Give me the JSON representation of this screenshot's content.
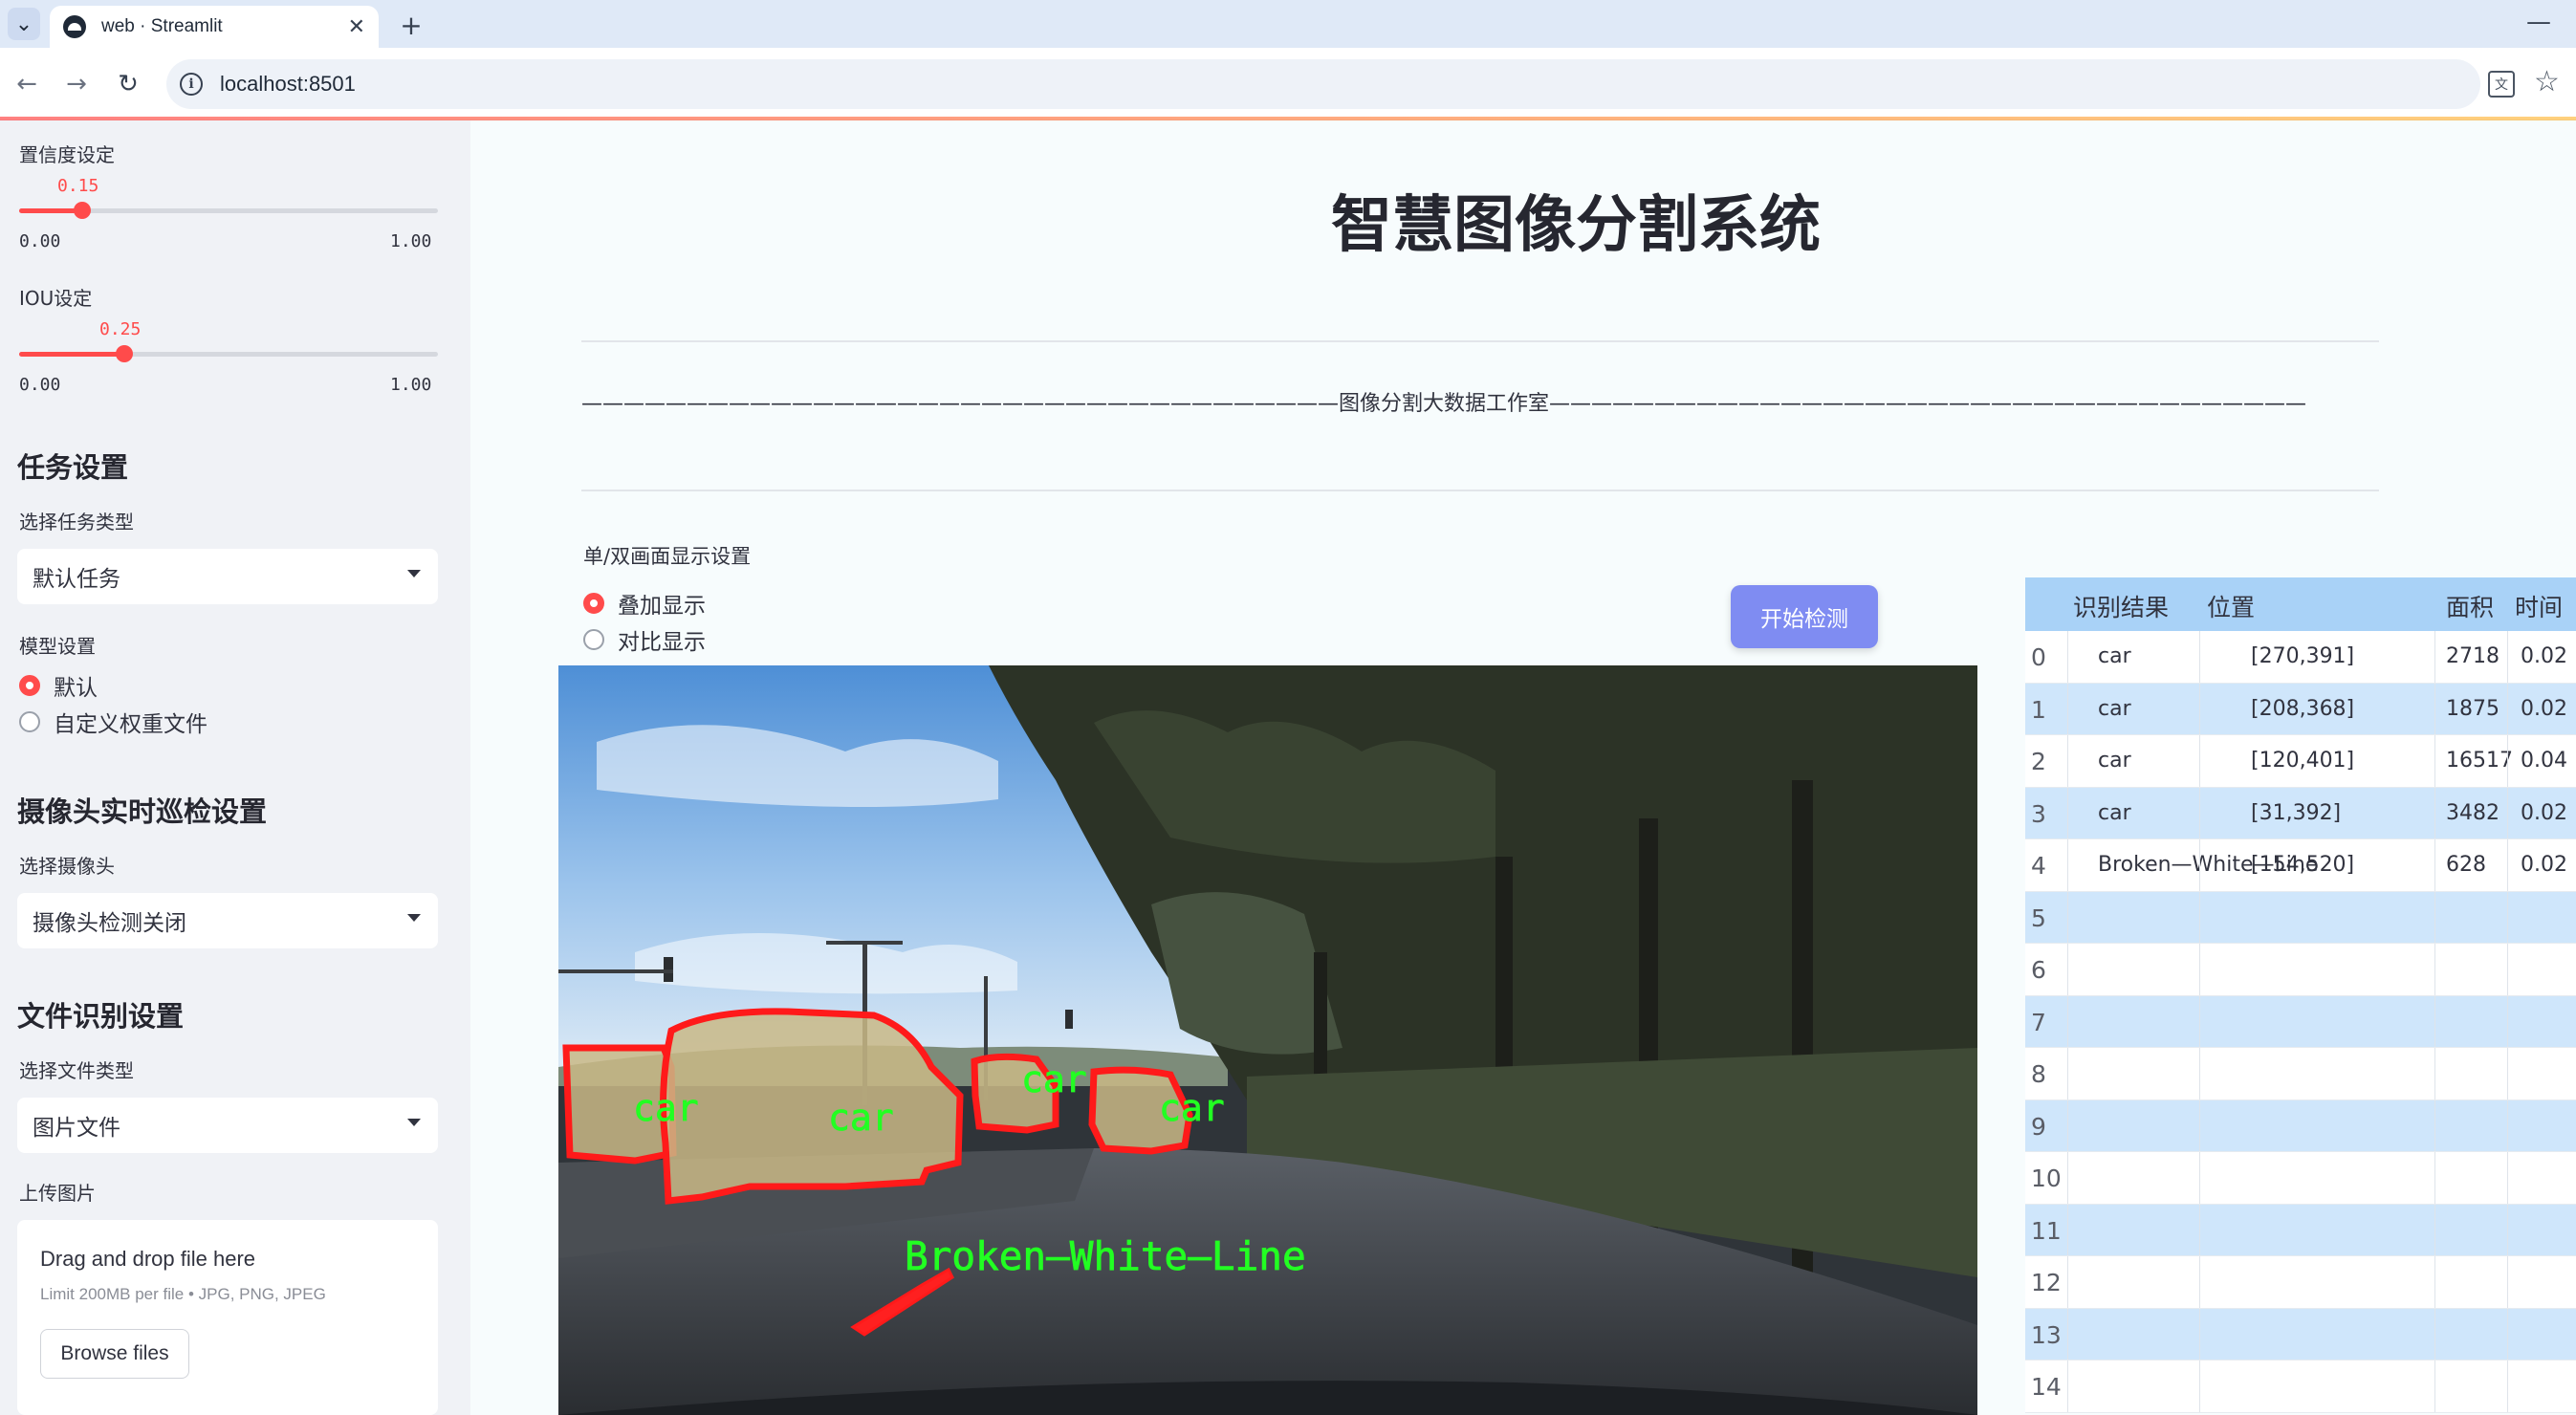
{
  "browser": {
    "tab_title": "web · Streamlit",
    "url": "localhost:8501"
  },
  "sidebar": {
    "confidence": {
      "label": "置信度设定",
      "value": "0.15",
      "min": "0.00",
      "max": "1.00",
      "fraction": 0.15
    },
    "iou": {
      "label": "IOU设定",
      "value": "0.25",
      "min": "0.00",
      "max": "1.00",
      "fraction": 0.25
    },
    "task_heading": "任务设置",
    "task_type_label": "选择任务类型",
    "task_type_value": "默认任务",
    "model_label": "模型设置",
    "model_options": [
      "默认",
      "自定义权重文件"
    ],
    "model_selected": 0,
    "camera_heading": "摄像头实时巡检设置",
    "camera_label": "选择摄像头",
    "camera_value": "摄像头检测关闭",
    "file_heading": "文件识别设置",
    "file_type_label": "选择文件类型",
    "file_type_value": "图片文件",
    "upload_label": "上传图片",
    "dropzone": {
      "title": "Drag and drop file here",
      "subtitle": "Limit 200MB per file • JPG, PNG, JPEG",
      "button": "Browse files"
    }
  },
  "main": {
    "title": "智慧图像分割系统",
    "banner": "————————————————————————————————————图像分割大数据工作室————————————————————————————————————",
    "display_label": "单/双画面显示设置",
    "display_options": [
      "叠加显示",
      "对比显示"
    ],
    "display_selected": 0,
    "start_button": "开始检测",
    "detections": [
      {
        "label": "car"
      },
      {
        "label": "car"
      },
      {
        "label": "car"
      },
      {
        "label": "car"
      },
      {
        "label": "Broken—White—Line"
      }
    ],
    "table": {
      "headers": [
        "识别结果",
        "位置",
        "面积",
        "时间"
      ],
      "rows": [
        {
          "idx": "0",
          "result": "car",
          "pos": "[270,391]",
          "area": "2718",
          "time": "0.02"
        },
        {
          "idx": "1",
          "result": "car",
          "pos": "[208,368]",
          "area": "1875",
          "time": "0.02"
        },
        {
          "idx": "2",
          "result": "car",
          "pos": "[120,401]",
          "area": "16517",
          "time": "0.04"
        },
        {
          "idx": "3",
          "result": "car",
          "pos": "[31,392]",
          "area": "3482",
          "time": "0.02"
        },
        {
          "idx": "4",
          "result": "Broken—White—Line",
          "pos": "[154,520]",
          "area": "628",
          "time": "0.02"
        },
        {
          "idx": "5",
          "result": "",
          "pos": "",
          "area": "",
          "time": ""
        },
        {
          "idx": "6",
          "result": "",
          "pos": "",
          "area": "",
          "time": ""
        },
        {
          "idx": "7",
          "result": "",
          "pos": "",
          "area": "",
          "time": ""
        },
        {
          "idx": "8",
          "result": "",
          "pos": "",
          "area": "",
          "time": ""
        },
        {
          "idx": "9",
          "result": "",
          "pos": "",
          "area": "",
          "time": ""
        },
        {
          "idx": "10",
          "result": "",
          "pos": "",
          "area": "",
          "time": ""
        },
        {
          "idx": "11",
          "result": "",
          "pos": "",
          "area": "",
          "time": ""
        },
        {
          "idx": "12",
          "result": "",
          "pos": "",
          "area": "",
          "time": ""
        },
        {
          "idx": "13",
          "result": "",
          "pos": "",
          "area": "",
          "time": ""
        },
        {
          "idx": "14",
          "result": "",
          "pos": "",
          "area": "",
          "time": ""
        }
      ]
    }
  },
  "colors": {
    "accent": "#ff4b4b",
    "start_button": "#7f8cf2",
    "table_header": "#a9d2f7",
    "table_alt_row": "#cfe6fb",
    "mask_outline": "#ff0000",
    "label_text": "#22ff22"
  }
}
